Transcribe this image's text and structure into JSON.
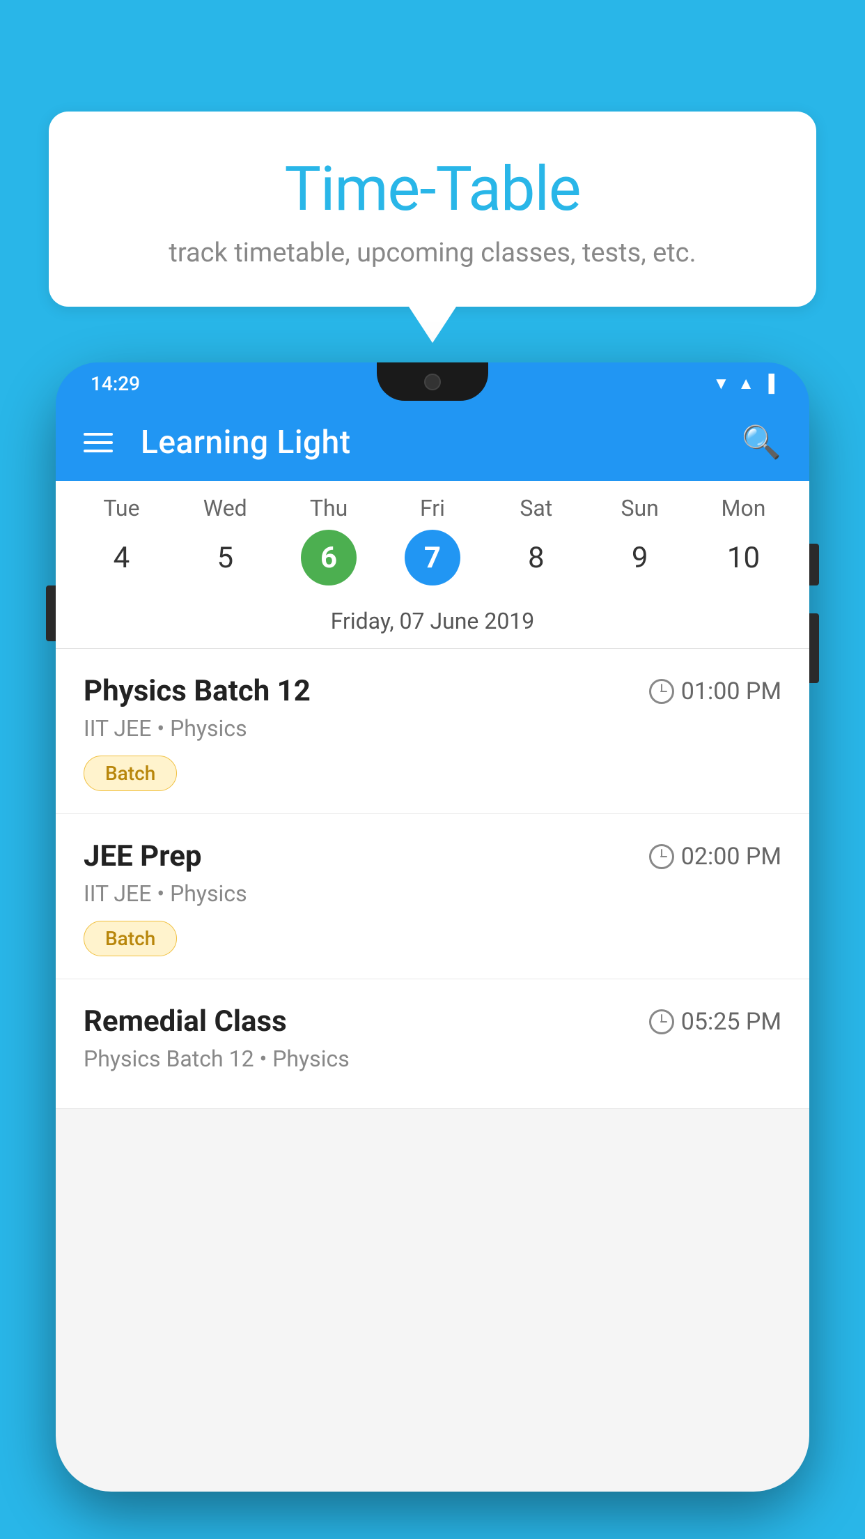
{
  "background_color": "#29b6e8",
  "speech_bubble": {
    "title": "Time-Table",
    "subtitle": "track timetable, upcoming classes, tests, etc."
  },
  "phone": {
    "status_bar": {
      "time": "14:29"
    },
    "app_bar": {
      "title": "Learning Light"
    },
    "calendar": {
      "days": [
        {
          "name": "Tue",
          "num": "4",
          "state": "normal"
        },
        {
          "name": "Wed",
          "num": "5",
          "state": "normal"
        },
        {
          "name": "Thu",
          "num": "6",
          "state": "today"
        },
        {
          "name": "Fri",
          "num": "7",
          "state": "selected"
        },
        {
          "name": "Sat",
          "num": "8",
          "state": "normal"
        },
        {
          "name": "Sun",
          "num": "9",
          "state": "normal"
        },
        {
          "name": "Mon",
          "num": "10",
          "state": "normal"
        }
      ],
      "selected_date_label": "Friday, 07 June 2019"
    },
    "schedule": [
      {
        "title": "Physics Batch 12",
        "time": "01:00 PM",
        "meta": "IIT JEE • Physics",
        "badge": "Batch"
      },
      {
        "title": "JEE Prep",
        "time": "02:00 PM",
        "meta": "IIT JEE • Physics",
        "badge": "Batch"
      },
      {
        "title": "Remedial Class",
        "time": "05:25 PM",
        "meta": "Physics Batch 12 • Physics",
        "badge": ""
      }
    ]
  }
}
